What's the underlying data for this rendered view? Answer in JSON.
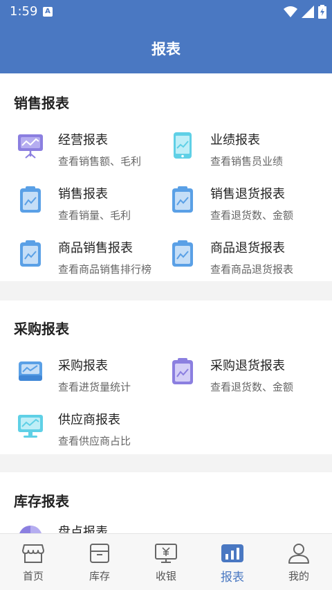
{
  "status_bar": {
    "time": "1:59",
    "notification_icon": "A"
  },
  "header": {
    "title": "报表"
  },
  "sections": [
    {
      "title": "销售报表",
      "items": [
        {
          "title": "经营报表",
          "subtitle": "查看销售额、毛利",
          "icon": "presentation-chart-icon"
        },
        {
          "title": "业绩报表",
          "subtitle": "查看销售员业绩",
          "icon": "tablet-chart-icon"
        },
        {
          "title": "销售报表",
          "subtitle": "查看销量、毛利",
          "icon": "clipboard-chart-icon"
        },
        {
          "title": "销售退货报表",
          "subtitle": "查看退货数、金额",
          "icon": "clipboard-chart-icon"
        },
        {
          "title": "商品销售报表",
          "subtitle": "查看商品销售排行榜",
          "icon": "clipboard-chart-icon"
        },
        {
          "title": "商品退货报表",
          "subtitle": "查看商品退货报表",
          "icon": "clipboard-chart-icon"
        }
      ]
    },
    {
      "title": "采购报表",
      "items": [
        {
          "title": "采购报表",
          "subtitle": "查看进货量统计",
          "icon": "tray-chart-icon"
        },
        {
          "title": "采购退货报表",
          "subtitle": "查看退货数、金额",
          "icon": "clipboard-chart-icon"
        },
        {
          "title": "供应商报表",
          "subtitle": "查看供应商占比",
          "icon": "monitor-chart-icon"
        }
      ]
    },
    {
      "title": "库存报表",
      "items": [
        {
          "title": "盘点报表",
          "subtitle": "",
          "icon": "pie-chart-icon"
        }
      ]
    }
  ],
  "tabs": [
    {
      "label": "首页",
      "icon": "store-icon",
      "active": false
    },
    {
      "label": "库存",
      "icon": "box-icon",
      "active": false
    },
    {
      "label": "收银",
      "icon": "cashier-icon",
      "active": false
    },
    {
      "label": "报表",
      "icon": "bar-chart-icon",
      "active": true
    },
    {
      "label": "我的",
      "icon": "user-icon",
      "active": false
    }
  ],
  "colors": {
    "primary": "#4a78c2",
    "icon_purple": "#8b7fe0",
    "icon_cyan": "#5fd0e6",
    "icon_blue": "#5aa0e6",
    "divider": "#f3f3f3"
  }
}
